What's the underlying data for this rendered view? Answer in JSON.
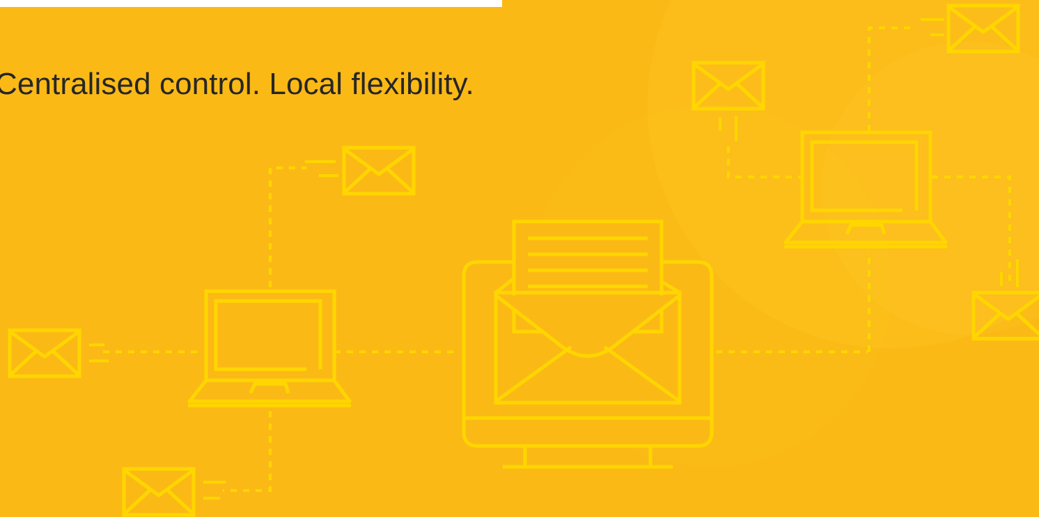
{
  "banner": {
    "headline": "Centralised control. Local flexibility."
  },
  "theme": {
    "background": "#FBB916",
    "line_color": "#FFD600",
    "headline_color": "#262626",
    "top_bar_color": "#FFFFFF"
  },
  "icons": [
    "envelope-icon",
    "laptop-icon",
    "desktop-monitor-icon",
    "open-envelope-letter-icon"
  ]
}
